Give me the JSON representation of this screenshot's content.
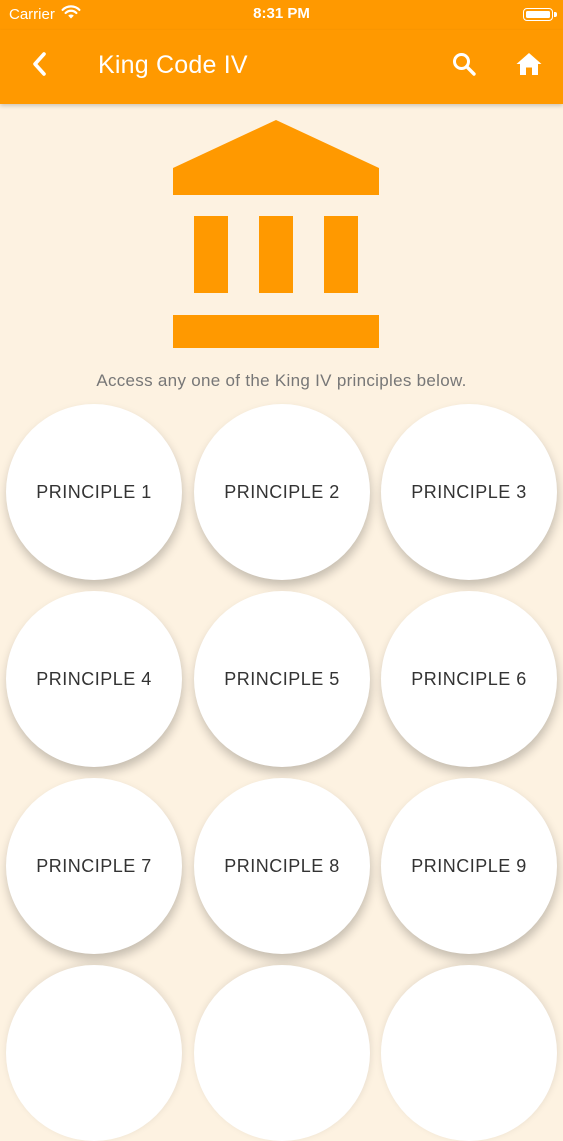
{
  "status_bar": {
    "carrier": "Carrier",
    "time": "8:31 PM",
    "icons": [
      "wifi-icon",
      "battery-icon"
    ]
  },
  "nav": {
    "title": "King Code IV",
    "icons": [
      "chevron-left-icon",
      "search-icon",
      "home-icon"
    ]
  },
  "hero": {
    "icon": "institution-icon"
  },
  "intro": "Access any one of the King IV principles below.",
  "principles": [
    {
      "label": "PRINCIPLE 1"
    },
    {
      "label": "PRINCIPLE 2"
    },
    {
      "label": "PRINCIPLE 3"
    },
    {
      "label": "PRINCIPLE 4"
    },
    {
      "label": "PRINCIPLE 5"
    },
    {
      "label": "PRINCIPLE 6"
    },
    {
      "label": "PRINCIPLE 7"
    },
    {
      "label": "PRINCIPLE 8"
    },
    {
      "label": "PRINCIPLE 9"
    }
  ],
  "colors": {
    "primary": "#FF9900",
    "background": "#FDF2E1",
    "circle": "#FFFFFF",
    "text": "#333333",
    "muted_text": "#777777"
  }
}
